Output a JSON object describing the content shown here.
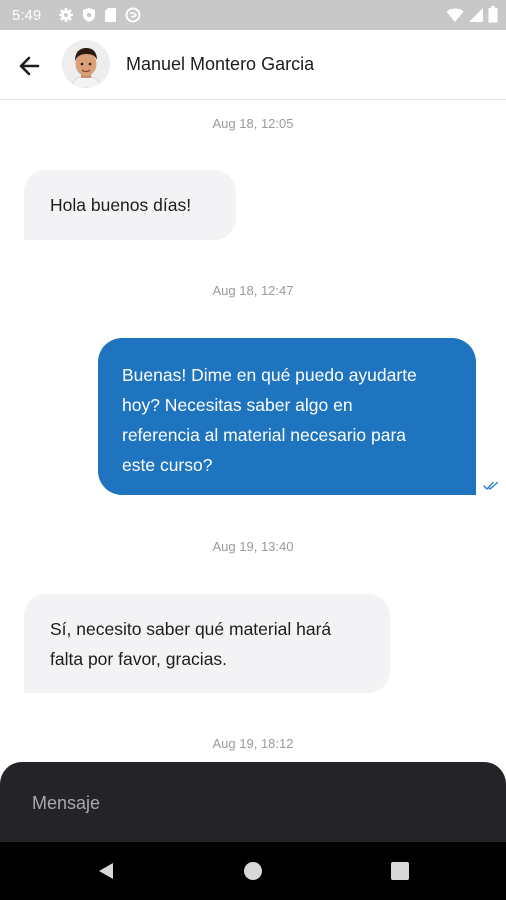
{
  "status_bar": {
    "time": "5:49",
    "icons": [
      "gear-icon",
      "shield-icon",
      "sd-card-icon",
      "no-disturb-icon",
      "wifi-icon",
      "signal-icon",
      "battery-icon"
    ]
  },
  "header": {
    "contact_name": "Manuel Montero Garcia",
    "back_icon": "arrow-left-icon"
  },
  "messages": [
    {
      "timestamp": "Aug 18, 12:05",
      "direction": "incoming",
      "text": "Hola buenos días!"
    },
    {
      "timestamp": "Aug 18, 12:47",
      "direction": "outgoing",
      "text_lines": [
        "Buenas! Dime en qué puedo ayudarte",
        "hoy? Necesitas saber algo en",
        "referencia al material necesario para",
        "este curso?"
      ],
      "status": "read"
    },
    {
      "timestamp": "Aug 19, 13:40",
      "direction": "incoming",
      "text_lines": [
        "Sí, necesito saber qué material hará",
        "falta por favor, gracias."
      ]
    },
    {
      "timestamp": "Aug 19, 18:12"
    }
  ],
  "composer": {
    "placeholder": "Mensaje"
  },
  "colors": {
    "outgoing_bubble": "#1e74bf",
    "incoming_bubble": "#f3f3f5",
    "composer_bg": "#242428"
  }
}
